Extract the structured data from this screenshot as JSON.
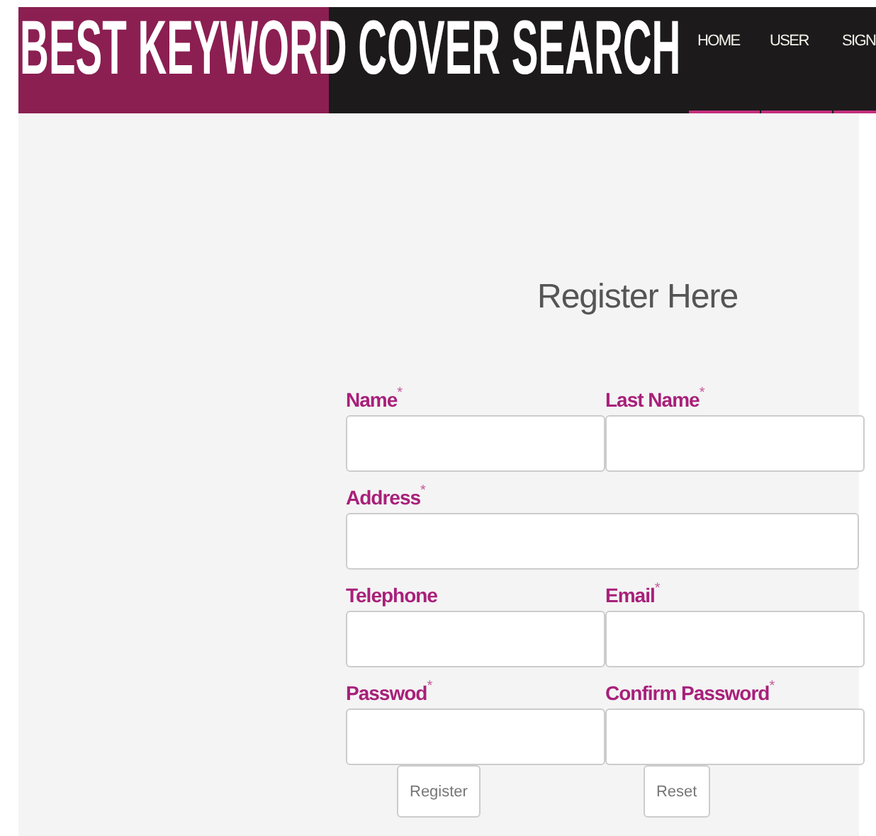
{
  "header": {
    "title": "BEST KEYWORD COVER SEARCH",
    "nav": [
      {
        "label": "HOME"
      },
      {
        "label": "USER"
      },
      {
        "label": "SIGN"
      }
    ]
  },
  "form": {
    "heading": "Register Here",
    "rows": [
      [
        {
          "label": "Name",
          "mark": "*"
        },
        {
          "label": "Last Name",
          "mark": "*"
        }
      ],
      [
        {
          "label": "Address",
          "mark": "*"
        }
      ],
      [
        {
          "label": "Telephone"
        },
        {
          "label": "Email",
          "mark": "*"
        }
      ],
      [
        {
          "label": "Passwod",
          "mark": "*"
        },
        {
          "label": "Confirm Password",
          "mark": "*"
        }
      ]
    ],
    "buttons": [
      "Register",
      "Reset"
    ]
  }
}
